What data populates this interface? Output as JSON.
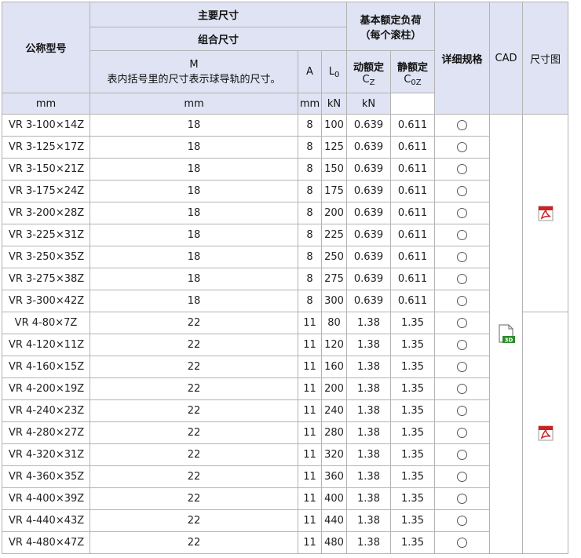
{
  "header": {
    "model": "公称型号",
    "main_dims": "主要尺寸",
    "combo_dims": "组合尺寸",
    "m_label": "M",
    "m_note": "表内括号里的尺寸表示球导轨的尺寸。",
    "a_label": "A",
    "l_label": "L",
    "l_sub": "0",
    "load_rating": "基本额定负荷",
    "load_rating_note": "（每个滚柱）",
    "dynamic": "动额定",
    "dynamic_sym": "C",
    "dynamic_sub": "Z",
    "static": "静额定",
    "static_sym": "C",
    "static_sub": "0Z",
    "spec": "详细规格",
    "cad": "CAD",
    "drawing": "尺寸图"
  },
  "units": {
    "m": "mm",
    "a": "mm",
    "l": "mm",
    "c": "kN",
    "c0": "kN"
  },
  "rows": [
    {
      "model": "VR 3-100×14Z",
      "m": "18",
      "a": "8",
      "l": "100",
      "c": "0.639",
      "c0": "0.611"
    },
    {
      "model": "VR 3-125×17Z",
      "m": "18",
      "a": "8",
      "l": "125",
      "c": "0.639",
      "c0": "0.611"
    },
    {
      "model": "VR 3-150×21Z",
      "m": "18",
      "a": "8",
      "l": "150",
      "c": "0.639",
      "c0": "0.611"
    },
    {
      "model": "VR 3-175×24Z",
      "m": "18",
      "a": "8",
      "l": "175",
      "c": "0.639",
      "c0": "0.611"
    },
    {
      "model": "VR 3-200×28Z",
      "m": "18",
      "a": "8",
      "l": "200",
      "c": "0.639",
      "c0": "0.611"
    },
    {
      "model": "VR 3-225×31Z",
      "m": "18",
      "a": "8",
      "l": "225",
      "c": "0.639",
      "c0": "0.611"
    },
    {
      "model": "VR 3-250×35Z",
      "m": "18",
      "a": "8",
      "l": "250",
      "c": "0.639",
      "c0": "0.611"
    },
    {
      "model": "VR 3-275×38Z",
      "m": "18",
      "a": "8",
      "l": "275",
      "c": "0.639",
      "c0": "0.611"
    },
    {
      "model": "VR 3-300×42Z",
      "m": "18",
      "a": "8",
      "l": "300",
      "c": "0.639",
      "c0": "0.611"
    },
    {
      "model": "VR 4-80×7Z",
      "m": "22",
      "a": "11",
      "l": "80",
      "c": "1.38",
      "c0": "1.35"
    },
    {
      "model": "VR 4-120×11Z",
      "m": "22",
      "a": "11",
      "l": "120",
      "c": "1.38",
      "c0": "1.35"
    },
    {
      "model": "VR 4-160×15Z",
      "m": "22",
      "a": "11",
      "l": "160",
      "c": "1.38",
      "c0": "1.35"
    },
    {
      "model": "VR 4-200×19Z",
      "m": "22",
      "a": "11",
      "l": "200",
      "c": "1.38",
      "c0": "1.35"
    },
    {
      "model": "VR 4-240×23Z",
      "m": "22",
      "a": "11",
      "l": "240",
      "c": "1.38",
      "c0": "1.35"
    },
    {
      "model": "VR 4-280×27Z",
      "m": "22",
      "a": "11",
      "l": "280",
      "c": "1.38",
      "c0": "1.35"
    },
    {
      "model": "VR 4-320×31Z",
      "m": "22",
      "a": "11",
      "l": "320",
      "c": "1.38",
      "c0": "1.35"
    },
    {
      "model": "VR 4-360×35Z",
      "m": "22",
      "a": "11",
      "l": "360",
      "c": "1.38",
      "c0": "1.35"
    },
    {
      "model": "VR 4-400×39Z",
      "m": "22",
      "a": "11",
      "l": "400",
      "c": "1.38",
      "c0": "1.35"
    },
    {
      "model": "VR 4-440×43Z",
      "m": "22",
      "a": "11",
      "l": "440",
      "c": "1.38",
      "c0": "1.35"
    },
    {
      "model": "VR 4-480×47Z",
      "m": "22",
      "a": "11",
      "l": "480",
      "c": "1.38",
      "c0": "1.35"
    }
  ],
  "icons": {
    "spec": "circle-icon",
    "cad": "cad-3d-icon",
    "drawing": "pdf-icon",
    "pdf_red": "#cc2222",
    "cad_green": "#2e8b2e"
  }
}
